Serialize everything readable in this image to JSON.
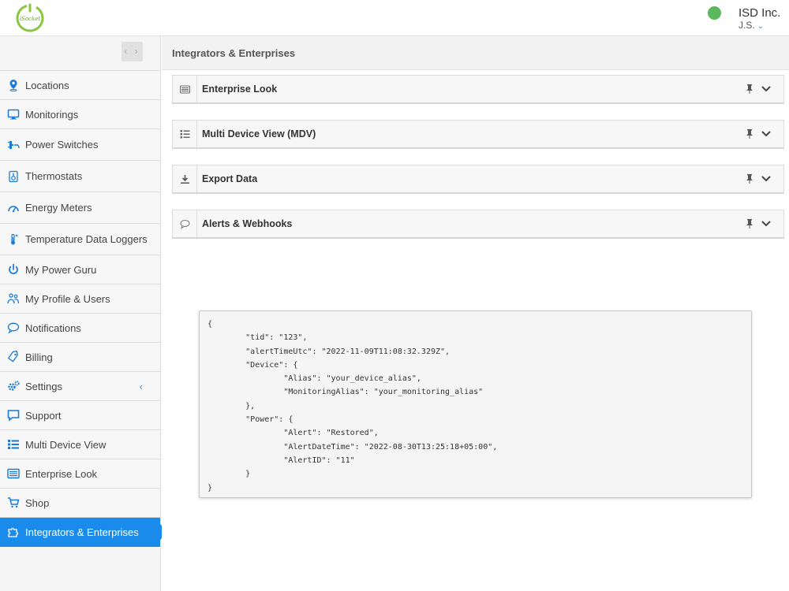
{
  "header": {
    "logo_text": "iSocket",
    "company": "ISD Inc.",
    "user": "J.S.",
    "status_color": "#5cb85c"
  },
  "sidebar": {
    "collapse_label": "‹ ›",
    "items": [
      {
        "label": "Locations",
        "icon": "location-pin-icon"
      },
      {
        "label": "Monitorings",
        "icon": "monitor-icon"
      },
      {
        "label": "Power Switches",
        "icon": "plug-icon"
      },
      {
        "label": "Thermostats",
        "icon": "thermostat-icon"
      },
      {
        "label": "Energy Meters",
        "icon": "gauge-icon"
      },
      {
        "label": "Temperature Data Loggers",
        "icon": "thermometer-icon"
      },
      {
        "label": "My Power Guru",
        "icon": "power-icon"
      },
      {
        "label": "My Profile & Users",
        "icon": "users-icon"
      },
      {
        "label": "Notifications",
        "icon": "speech-bubble-icon"
      },
      {
        "label": "Billing",
        "icon": "tag-icon"
      },
      {
        "label": "Settings",
        "icon": "gears-icon"
      },
      {
        "label": "Support",
        "icon": "chat-icon"
      },
      {
        "label": "Multi Device View",
        "icon": "list-icon"
      },
      {
        "label": "Enterprise Look",
        "icon": "card-list-icon"
      },
      {
        "label": "Shop",
        "icon": "cart-icon"
      },
      {
        "label": "Integrators & Enterprises",
        "icon": "puzzle-icon"
      }
    ],
    "settings_caret": "‹",
    "active_color": "#1a8bea"
  },
  "main": {
    "title": "Integrators & Enterprises",
    "panels": [
      {
        "title": "Enterprise Look",
        "icon": "card-icon"
      },
      {
        "title": "Multi Device View (MDV)",
        "icon": "list-icon"
      },
      {
        "title": "Export Data",
        "icon": "download-icon"
      },
      {
        "title": "Alerts & Webhooks",
        "icon": "speech-bubble-icon"
      }
    ],
    "code": "{\n        \"tid\": \"123\",\n        \"alertTimeUtc\": \"2022-11-09T11:08:32.329Z\",\n        \"Device\": {\n                \"Alias\": \"your_device_alias\",\n                \"MonitoringAlias\": \"your_monitoring_alias\"\n        },\n        \"Power\": {\n                \"Alert\": \"Restored\",\n                \"AlertDateTime\": \"2022-08-30T13:25:18+05:00\",\n                \"AlertID\": \"11\"\n        }\n}"
  }
}
